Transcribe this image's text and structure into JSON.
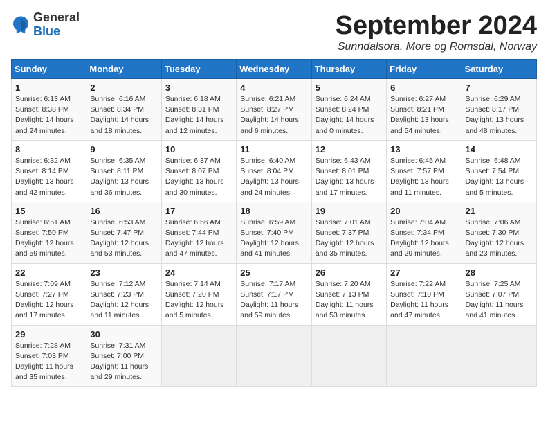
{
  "logo": {
    "general": "General",
    "blue": "Blue"
  },
  "header": {
    "month_title": "September 2024",
    "subtitle": "Sunndalsora, More og Romsdal, Norway"
  },
  "weekdays": [
    "Sunday",
    "Monday",
    "Tuesday",
    "Wednesday",
    "Thursday",
    "Friday",
    "Saturday"
  ],
  "weeks": [
    [
      {
        "day": "1",
        "info": "Sunrise: 6:13 AM\nSunset: 8:38 PM\nDaylight: 14 hours\nand 24 minutes."
      },
      {
        "day": "2",
        "info": "Sunrise: 6:16 AM\nSunset: 8:34 PM\nDaylight: 14 hours\nand 18 minutes."
      },
      {
        "day": "3",
        "info": "Sunrise: 6:18 AM\nSunset: 8:31 PM\nDaylight: 14 hours\nand 12 minutes."
      },
      {
        "day": "4",
        "info": "Sunrise: 6:21 AM\nSunset: 8:27 PM\nDaylight: 14 hours\nand 6 minutes."
      },
      {
        "day": "5",
        "info": "Sunrise: 6:24 AM\nSunset: 8:24 PM\nDaylight: 14 hours\nand 0 minutes."
      },
      {
        "day": "6",
        "info": "Sunrise: 6:27 AM\nSunset: 8:21 PM\nDaylight: 13 hours\nand 54 minutes."
      },
      {
        "day": "7",
        "info": "Sunrise: 6:29 AM\nSunset: 8:17 PM\nDaylight: 13 hours\nand 48 minutes."
      }
    ],
    [
      {
        "day": "8",
        "info": "Sunrise: 6:32 AM\nSunset: 8:14 PM\nDaylight: 13 hours\nand 42 minutes."
      },
      {
        "day": "9",
        "info": "Sunrise: 6:35 AM\nSunset: 8:11 PM\nDaylight: 13 hours\nand 36 minutes."
      },
      {
        "day": "10",
        "info": "Sunrise: 6:37 AM\nSunset: 8:07 PM\nDaylight: 13 hours\nand 30 minutes."
      },
      {
        "day": "11",
        "info": "Sunrise: 6:40 AM\nSunset: 8:04 PM\nDaylight: 13 hours\nand 24 minutes."
      },
      {
        "day": "12",
        "info": "Sunrise: 6:43 AM\nSunset: 8:01 PM\nDaylight: 13 hours\nand 17 minutes."
      },
      {
        "day": "13",
        "info": "Sunrise: 6:45 AM\nSunset: 7:57 PM\nDaylight: 13 hours\nand 11 minutes."
      },
      {
        "day": "14",
        "info": "Sunrise: 6:48 AM\nSunset: 7:54 PM\nDaylight: 13 hours\nand 5 minutes."
      }
    ],
    [
      {
        "day": "15",
        "info": "Sunrise: 6:51 AM\nSunset: 7:50 PM\nDaylight: 12 hours\nand 59 minutes."
      },
      {
        "day": "16",
        "info": "Sunrise: 6:53 AM\nSunset: 7:47 PM\nDaylight: 12 hours\nand 53 minutes."
      },
      {
        "day": "17",
        "info": "Sunrise: 6:56 AM\nSunset: 7:44 PM\nDaylight: 12 hours\nand 47 minutes."
      },
      {
        "day": "18",
        "info": "Sunrise: 6:59 AM\nSunset: 7:40 PM\nDaylight: 12 hours\nand 41 minutes."
      },
      {
        "day": "19",
        "info": "Sunrise: 7:01 AM\nSunset: 7:37 PM\nDaylight: 12 hours\nand 35 minutes."
      },
      {
        "day": "20",
        "info": "Sunrise: 7:04 AM\nSunset: 7:34 PM\nDaylight: 12 hours\nand 29 minutes."
      },
      {
        "day": "21",
        "info": "Sunrise: 7:06 AM\nSunset: 7:30 PM\nDaylight: 12 hours\nand 23 minutes."
      }
    ],
    [
      {
        "day": "22",
        "info": "Sunrise: 7:09 AM\nSunset: 7:27 PM\nDaylight: 12 hours\nand 17 minutes."
      },
      {
        "day": "23",
        "info": "Sunrise: 7:12 AM\nSunset: 7:23 PM\nDaylight: 12 hours\nand 11 minutes."
      },
      {
        "day": "24",
        "info": "Sunrise: 7:14 AM\nSunset: 7:20 PM\nDaylight: 12 hours\nand 5 minutes."
      },
      {
        "day": "25",
        "info": "Sunrise: 7:17 AM\nSunset: 7:17 PM\nDaylight: 11 hours\nand 59 minutes."
      },
      {
        "day": "26",
        "info": "Sunrise: 7:20 AM\nSunset: 7:13 PM\nDaylight: 11 hours\nand 53 minutes."
      },
      {
        "day": "27",
        "info": "Sunrise: 7:22 AM\nSunset: 7:10 PM\nDaylight: 11 hours\nand 47 minutes."
      },
      {
        "day": "28",
        "info": "Sunrise: 7:25 AM\nSunset: 7:07 PM\nDaylight: 11 hours\nand 41 minutes."
      }
    ],
    [
      {
        "day": "29",
        "info": "Sunrise: 7:28 AM\nSunset: 7:03 PM\nDaylight: 11 hours\nand 35 minutes."
      },
      {
        "day": "30",
        "info": "Sunrise: 7:31 AM\nSunset: 7:00 PM\nDaylight: 11 hours\nand 29 minutes."
      },
      null,
      null,
      null,
      null,
      null
    ]
  ]
}
